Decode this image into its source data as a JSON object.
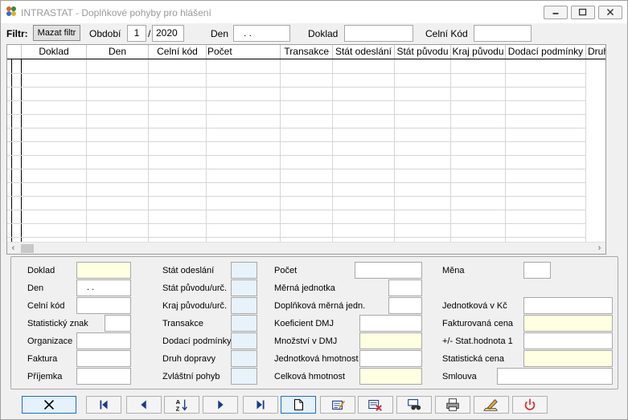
{
  "window": {
    "title": "INTRASTAT - Doplňkové pohyby pro hlášení"
  },
  "filter": {
    "label": "Filtr:",
    "clear_button": "Mazat filtr",
    "period_label": "Období",
    "period_month": "1",
    "period_sep": "/",
    "period_year": "2020",
    "day_label": "Den",
    "day_value": ". .",
    "document_label": "Doklad",
    "document_value": "",
    "customs_label": "Celní Kód",
    "customs_value": ""
  },
  "grid": {
    "columns": [
      "Doklad",
      "Den",
      "Celní kód",
      "Počet",
      "Transakce",
      "Stát odeslání",
      "Stát původu",
      "Kraj původu",
      "Dodací podmínky",
      "Druh"
    ],
    "scroll_left": "‹",
    "scroll_right": "›"
  },
  "detail": {
    "col1": [
      {
        "label": "Doklad",
        "value": ""
      },
      {
        "label": "Den",
        "value": ". ."
      },
      {
        "label": "Celní kód",
        "value": ""
      },
      {
        "label": "Statistický znak",
        "value": ""
      },
      {
        "label": "Organizace",
        "value": ""
      },
      {
        "label": "Faktura",
        "value": ""
      },
      {
        "label": "Příjemka",
        "value": ""
      }
    ],
    "col2": [
      {
        "label": "Stát odeslání",
        "value": ""
      },
      {
        "label": "Stát původu/urč.",
        "value": ""
      },
      {
        "label": "Kraj původu/urč.",
        "value": ""
      },
      {
        "label": "Transakce",
        "value": ""
      },
      {
        "label": "Dodací podmínky",
        "value": ""
      },
      {
        "label": "Druh dopravy",
        "value": ""
      },
      {
        "label": "Zvláštní pohyb",
        "value": ""
      }
    ],
    "col3": [
      {
        "label": "Počet",
        "value": ""
      },
      {
        "label": "Měrná jednotka",
        "value": ""
      },
      {
        "label": "Doplňková měrná jedn.",
        "value": ""
      },
      {
        "label": "Koeficient DMJ",
        "value": ""
      },
      {
        "label": "Množství v DMJ",
        "value": ""
      },
      {
        "label": "Jednotková hmotnost",
        "value": ""
      },
      {
        "label": "Celková hmotnost",
        "value": ""
      }
    ],
    "col4": [
      {
        "label": "Měna",
        "value": ""
      },
      {
        "label": "Jednotková v Kč",
        "value": ""
      },
      {
        "label": "Fakturovaná cena",
        "value": ""
      },
      {
        "label": "+/- Stat.hodnota 1",
        "value": ""
      },
      {
        "label": "Statistická cena",
        "value": ""
      },
      {
        "label": "Smlouva",
        "value": ""
      }
    ]
  },
  "colors": {
    "accent": "#1b6fc7",
    "required_field": "#ffffe1",
    "code_field": "#e8f2fb",
    "close_red": "#d6262b"
  }
}
